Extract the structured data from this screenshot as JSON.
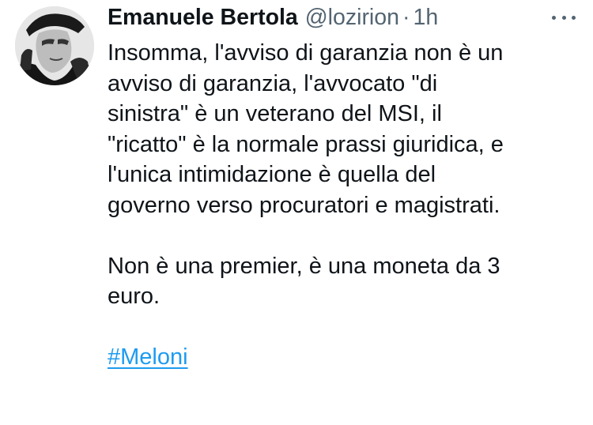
{
  "author": {
    "display_name": "Emanuele Bertola",
    "handle": "@lozirion",
    "separator": "·",
    "time": "1h",
    "avatar_icon": "profile-photo"
  },
  "menu": {
    "icon": "more-horizontal-icon"
  },
  "tweet": {
    "paragraph_1": "Insomma, l'avviso di garanzia non è un\navviso di garanzia, l'avvocato \"di\nsinistra\" è un veterano del MSI, il\n\"ricatto\" è la normale prassi giuridica, e\nl'unica intimidazione è quella del\ngoverno verso procuratori e magistrati.",
    "paragraph_2": "Non è una premier, è una moneta da 3\neuro.",
    "hashtag": "#Meloni"
  },
  "colors": {
    "text": "#0f1419",
    "secondary": "#536471",
    "link": "#1d9bf0",
    "background": "#ffffff"
  }
}
